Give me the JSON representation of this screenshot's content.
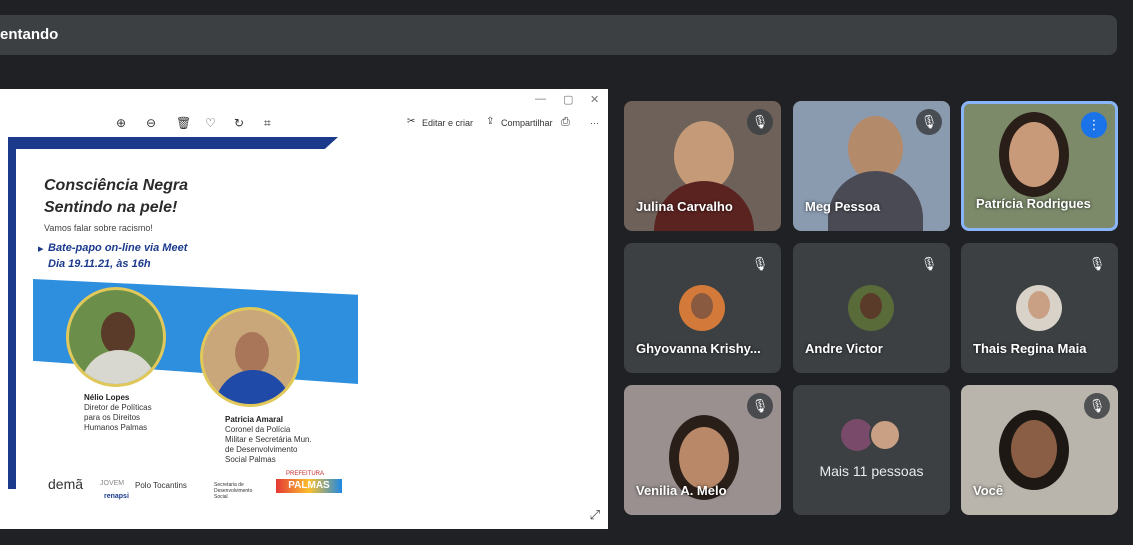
{
  "header": {
    "presenting_text": "entando"
  },
  "viewer": {
    "edit_label": "Editar e criar",
    "share_label": "Compartilhar",
    "more_label": "···",
    "win_min": "—",
    "win_max": "▢",
    "win_close": "✕"
  },
  "poster": {
    "title_line1": "Consciência Negra",
    "title_line2": "Sentindo na pele!",
    "subtitle": "Vamos falar sobre racismo!",
    "meet_line1": "Bate-papo on-line via Meet",
    "meet_line2": "Dia 19.11.21, às 16h",
    "speaker1": {
      "name": "Nélio Lopes",
      "role_l1": "Diretor de Políticas",
      "role_l2": "para os Direitos",
      "role_l3": "Humanos Palmas"
    },
    "speaker2": {
      "name": "Patricia Amaral",
      "role_l1": "Coronel da Polícia",
      "role_l2": "Militar e Secretária Mun.",
      "role_l3": "de Desenvolvimento",
      "role_l4": "Social Palmas"
    },
    "logo_dema": "demã",
    "logo_jovem": "JOVEM",
    "logo_renapsi": "renapsi",
    "polo": "Polo Tocantins",
    "secretaria": "Secretaria de Desenvolvimento Social",
    "prefeitura": "PREFEITURA",
    "palmas": "PALMAS"
  },
  "participants": [
    {
      "name": "Julina Carvalho"
    },
    {
      "name": "Meg Pessoa"
    },
    {
      "name": "Patrícia Rodrigues"
    },
    {
      "name": "Ghyovanna Krishy..."
    },
    {
      "name": "Andre Victor"
    },
    {
      "name": "Thais Regina Maia"
    },
    {
      "name": "Venilia A. Melo"
    },
    {
      "name": "Mais 11 pessoas"
    },
    {
      "name": "Você"
    }
  ],
  "colors": {
    "accent": "#8ab4f8",
    "tile_bg": "#3c4043",
    "page_bg": "#202124",
    "speaking": "#1a73e8"
  }
}
